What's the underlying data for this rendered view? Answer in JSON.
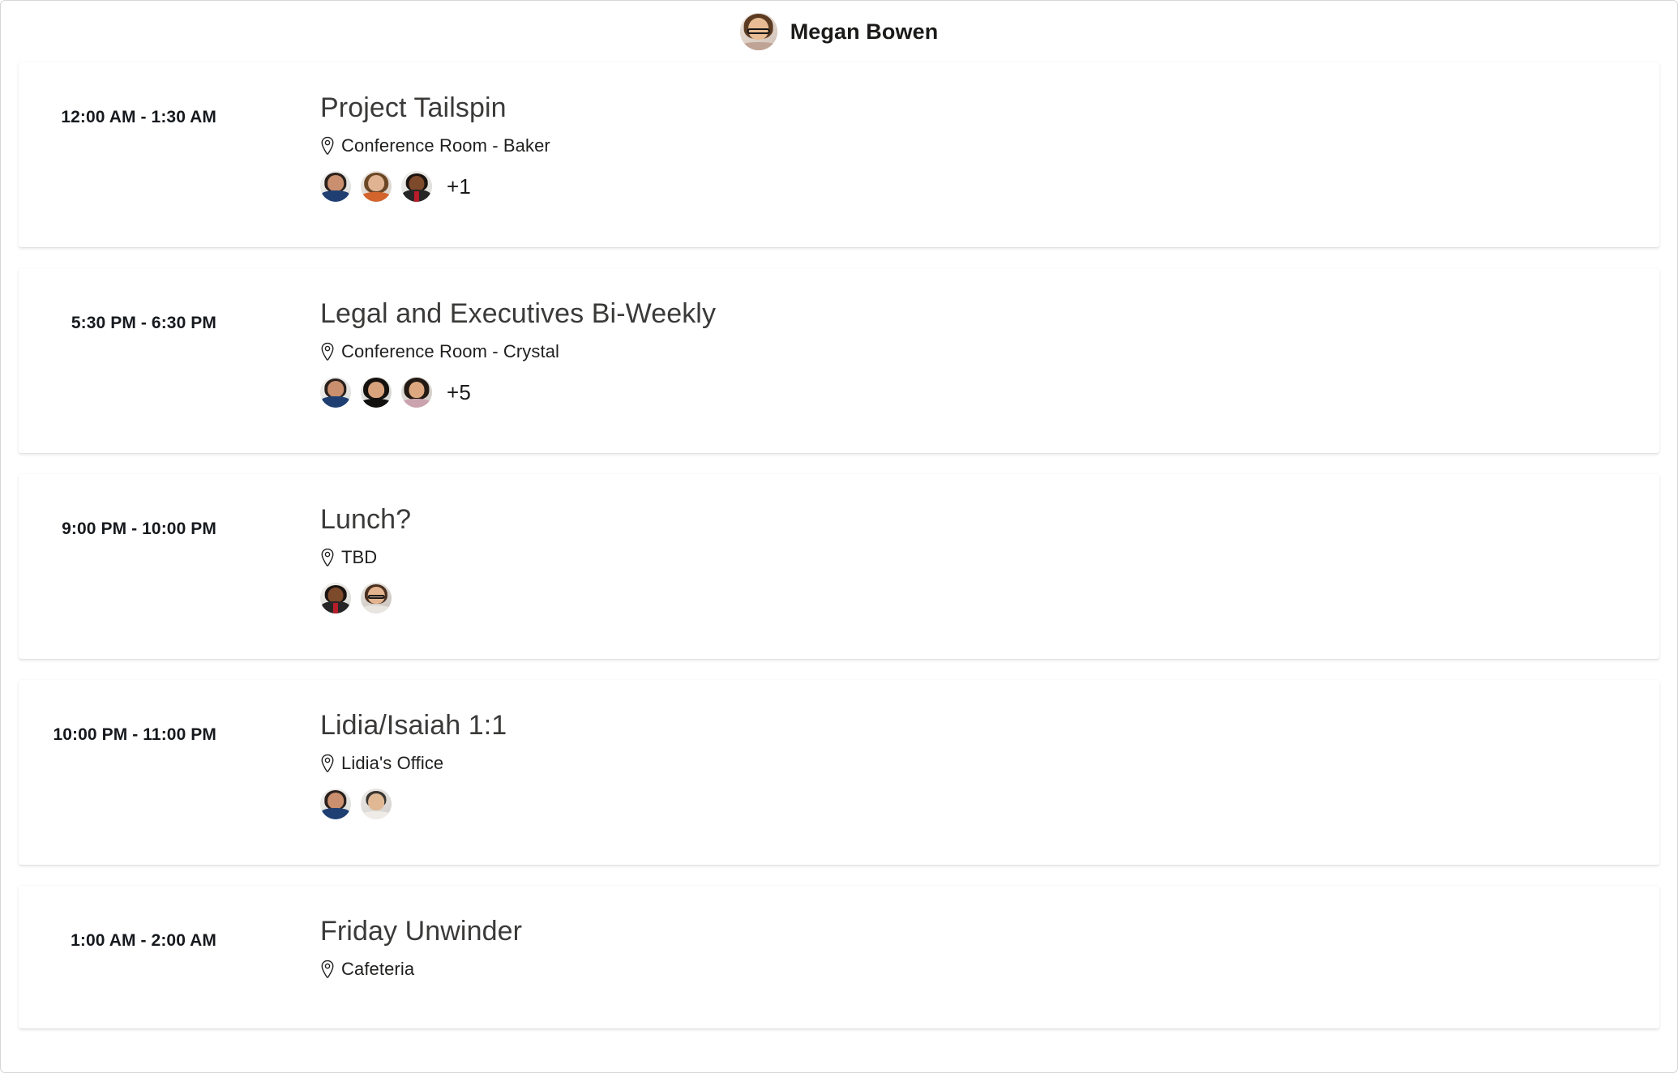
{
  "header": {
    "user_name": "Megan Bowen",
    "avatar_name": "megan-bowen-avatar"
  },
  "events": [
    {
      "time": "12:00 AM - 1:30 AM",
      "title": "Project Tailspin",
      "location": "Conference Room - Baker",
      "attendee_count": 3,
      "overflow": "+1",
      "has_attendees": true
    },
    {
      "time": "5:30 PM - 6:30 PM",
      "title": "Legal and Executives Bi-Weekly",
      "location": "Conference Room - Crystal",
      "attendee_count": 3,
      "overflow": "+5",
      "has_attendees": true
    },
    {
      "time": "9:00 PM - 10:00 PM",
      "title": "Lunch?",
      "location": "TBD",
      "attendee_count": 2,
      "overflow": "",
      "has_attendees": true
    },
    {
      "time": "10:00 PM - 11:00 PM",
      "title": "Lidia/Isaiah 1:1",
      "location": "Lidia's Office",
      "attendee_count": 2,
      "overflow": "",
      "has_attendees": true
    },
    {
      "time": "1:00 AM - 2:00 AM",
      "title": "Friday Unwinder",
      "location": "Cafeteria",
      "attendee_count": 0,
      "overflow": "",
      "has_attendees": false
    }
  ],
  "icons": {
    "location_pin": "location-pin-icon"
  },
  "colors": {
    "page_background": "#ffffff",
    "card_background": "#ffffff",
    "title_text": "#3b3a39",
    "time_text": "#16191d",
    "location_text": "#201f1e",
    "frame_border": "#d6d6d6"
  }
}
